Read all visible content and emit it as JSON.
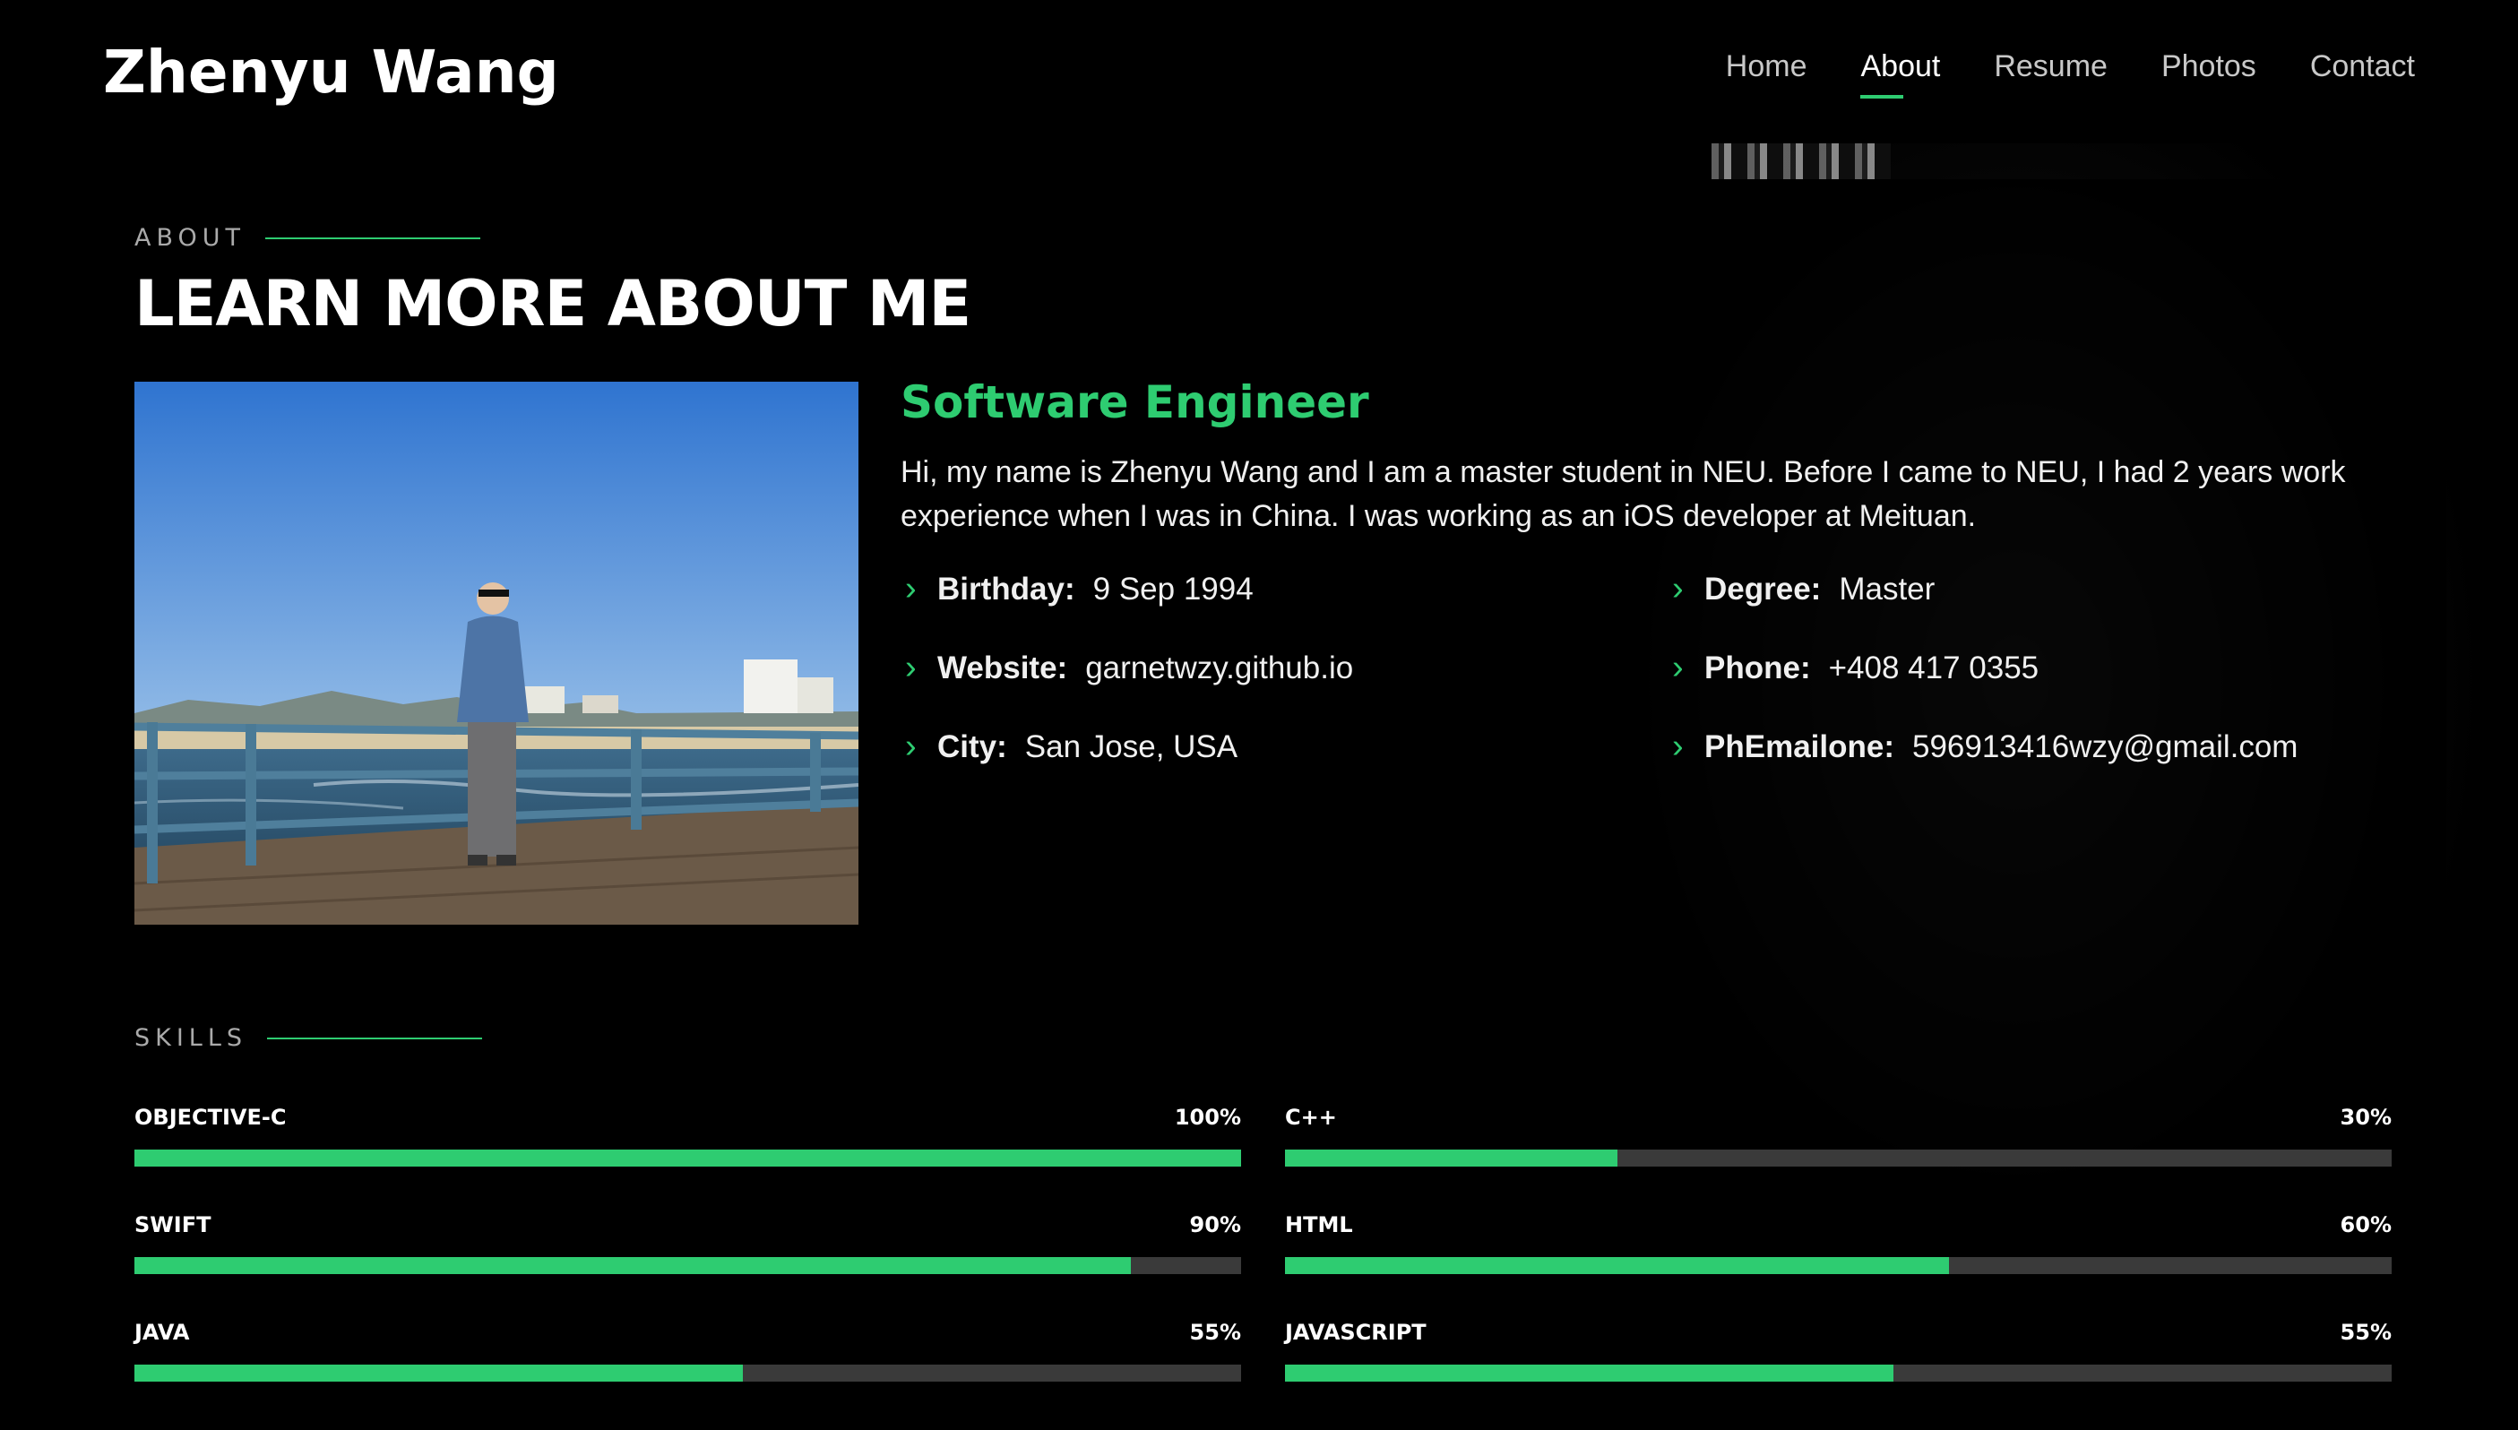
{
  "header": {
    "logo": "Zhenyu Wang",
    "nav": [
      {
        "label": "Home",
        "active": false
      },
      {
        "label": "About",
        "active": true
      },
      {
        "label": "Resume",
        "active": false
      },
      {
        "label": "Photos",
        "active": false
      },
      {
        "label": "Contact",
        "active": false
      }
    ]
  },
  "about": {
    "section_label": "ABOUT",
    "headline": "LEARN MORE ABOUT ME",
    "role": "Software Engineer",
    "bio": "Hi, my name is Zhenyu Wang and I am a master student in NEU. Before I came to NEU, I had 2 years work experience when I was in China. I was working as an iOS developer at Meituan.",
    "info": [
      {
        "key": "Birthday:",
        "value": "9 Sep 1994"
      },
      {
        "key": "Website:",
        "value": "garnetwzy.github.io"
      },
      {
        "key": "City:",
        "value": "San Jose, USA"
      },
      {
        "key": "Degree:",
        "value": "Master"
      },
      {
        "key": "Phone:",
        "value": "+408 417 0355"
      },
      {
        "key": "PhEmailone:",
        "value": "596913416wzy@gmail.com"
      }
    ]
  },
  "skills": {
    "section_label": "SKILLS",
    "items": [
      {
        "name": "OBJECTIVE-C",
        "percent_label": "100%",
        "percent": 100
      },
      {
        "name": "C++",
        "percent_label": "30%",
        "percent": 30
      },
      {
        "name": "SWIFT",
        "percent_label": "90%",
        "percent": 90
      },
      {
        "name": "HTML",
        "percent_label": "60%",
        "percent": 60
      },
      {
        "name": "JAVA",
        "percent_label": "55%",
        "percent": 55
      },
      {
        "name": "JAVASCRIPT",
        "percent_label": "55%",
        "percent": 55
      }
    ]
  },
  "colors": {
    "accent": "#2ecc71",
    "background": "#000000",
    "track": "#3a3a3a"
  }
}
